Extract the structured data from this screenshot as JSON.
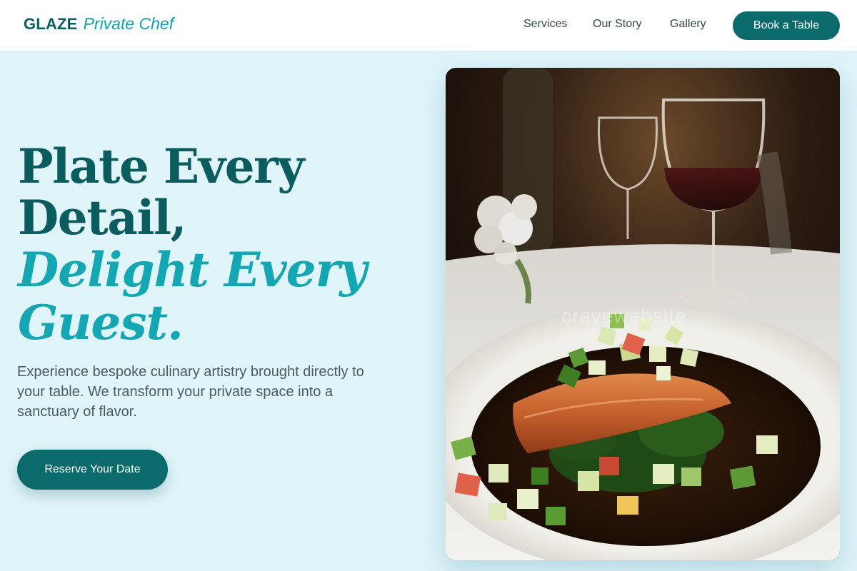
{
  "brand": {
    "name": "GLAZE",
    "tagline": "Private Chef"
  },
  "nav": {
    "items": [
      "Services",
      "Our Story",
      "Gallery"
    ],
    "cta": "Book a Table"
  },
  "hero": {
    "title_line1": "Plate Every",
    "title_line2": "Detail,",
    "title_italic1": "Delight Every",
    "title_italic2": "Guest.",
    "description": "Experience bespoke culinary artistry brought directly to your table. We transform your private space into a sanctuary of flavor.",
    "cta": "Reserve Your Date"
  },
  "colors": {
    "accent_dark": "#0b6a6c",
    "accent_light": "#14a6b3",
    "background": "#e0f5fa"
  }
}
